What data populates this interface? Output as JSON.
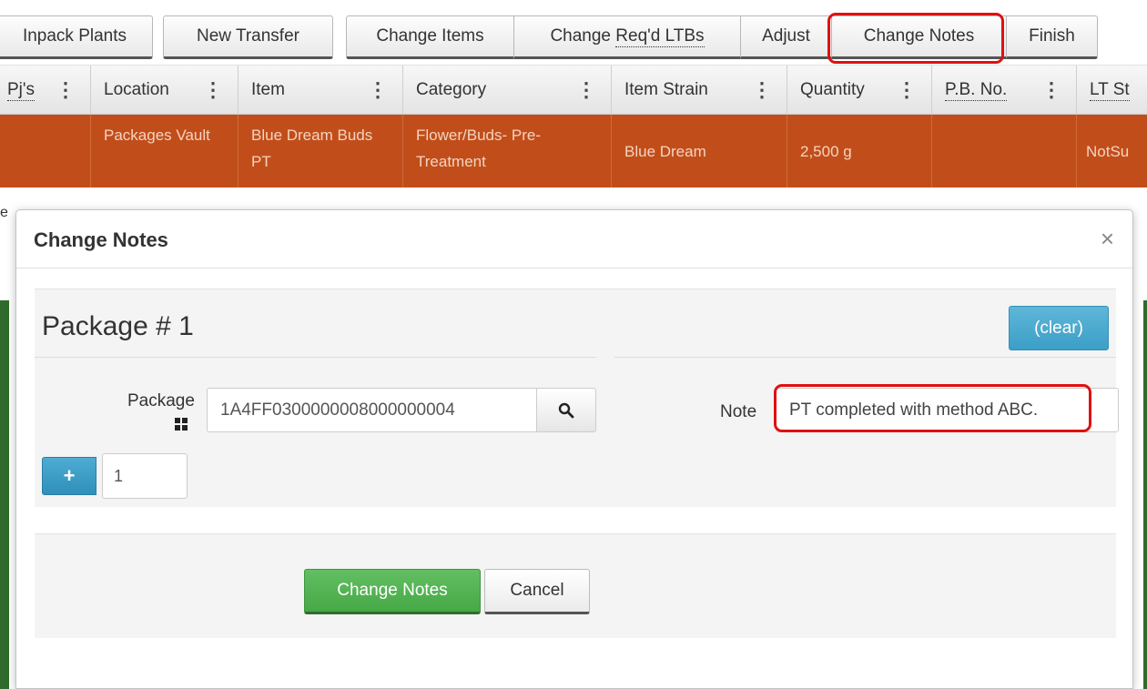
{
  "toolbar": {
    "unpack_plants": "Inpack Plants",
    "new_transfer": "New Transfer",
    "change_items": "Change Items",
    "change_reqd_ltbs_prefix": "Change ",
    "change_reqd_ltbs_rest": "Req'd LTBs",
    "adjust": "Adjust",
    "change_notes": "Change Notes",
    "finish": "Finish"
  },
  "grid": {
    "columns": [
      "Pj's",
      "Location",
      "Item",
      "Category",
      "Item Strain",
      "Quantity",
      "P.B. No.",
      "LT St"
    ],
    "row": {
      "pjs": "",
      "location": "Packages Vault",
      "item": "Blue Dream Buds PT",
      "category": "Flower/Buds- Pre-Treatment",
      "item_strain": "Blue Dream",
      "quantity": "2,500 g",
      "pb_no": "",
      "lt_status": "NotSu"
    }
  },
  "side_mark": "e",
  "modal": {
    "title": "Change Notes",
    "close_glyph": "×",
    "package_heading": "Package # 1",
    "clear_label": "(clear)",
    "package_label": "Package",
    "package_value": "1A4FF0300000008000000004",
    "note_label": "Note",
    "note_value": "PT completed with method ABC.",
    "add_glyph": "+",
    "count_value": "1",
    "submit_label": "Change Notes",
    "cancel_label": "Cancel"
  },
  "icons": {
    "search": "search-icon",
    "grid": "grid-icon",
    "close": "close-icon",
    "plus": "plus-icon"
  },
  "colors": {
    "row_selected": "#c14e1a",
    "primary": "#46a846",
    "info": "#3c9ec6",
    "highlight": "#e01010"
  }
}
